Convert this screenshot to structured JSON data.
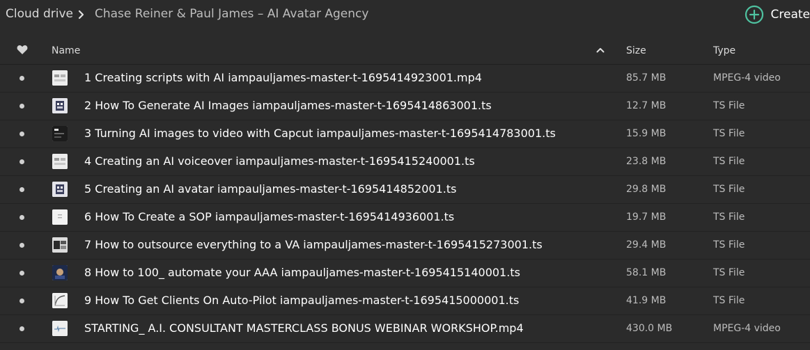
{
  "breadcrumb": {
    "root": "Cloud drive",
    "current": "Chase Reiner & Paul James – AI Avatar Agency"
  },
  "toolbar": {
    "create_label": "Create",
    "create_icon": "plus-circle-icon",
    "accent": "#4fc3a1"
  },
  "columns": {
    "favourite_icon": "heart-icon",
    "name": "Name",
    "size": "Size",
    "type": "Type",
    "sort_icon": "chevron-up-icon"
  },
  "files": [
    {
      "name": "1 Creating scripts with AI iampauljames-master-t-1695414923001.mp4",
      "size": "85.7 MB",
      "type": "MPEG-4 video",
      "thumb": "light"
    },
    {
      "name": "2 How To Generate AI Images iampauljames-master-t-1695414863001.ts",
      "size": "12.7 MB",
      "type": "TS File",
      "thumb": "grid"
    },
    {
      "name": "3 Turning AI images to video with Capcut iampauljames-master-t-1695414783001.ts",
      "size": "15.9 MB",
      "type": "TS File",
      "thumb": "dark"
    },
    {
      "name": "4 Creating an AI voiceover iampauljames-master-t-1695415240001.ts",
      "size": "23.8 MB",
      "type": "TS File",
      "thumb": "light"
    },
    {
      "name": "5 Creating an AI avatar iampauljames-master-t-1695414852001.ts",
      "size": "29.8 MB",
      "type": "TS File",
      "thumb": "grid"
    },
    {
      "name": "6 How To Create a SOP iampauljames-master-t-1695414936001.ts",
      "size": "19.7 MB",
      "type": "TS File",
      "thumb": "doc"
    },
    {
      "name": "7 How to outsource everything to a VA iampauljames-master-t-1695415273001.ts",
      "size": "29.4 MB",
      "type": "TS File",
      "thumb": "split"
    },
    {
      "name": "8 How to 100_ automate your AAA iampauljames-master-t-1695415140001.ts",
      "size": "58.1 MB",
      "type": "TS File",
      "thumb": "photo"
    },
    {
      "name": "9 How To Get Clients On Auto-Pilot iampauljames-master-t-1695415000001.ts",
      "size": "41.9 MB",
      "type": "TS File",
      "thumb": "curve"
    },
    {
      "name": "STARTING_ A.I. CONSULTANT MASTERCLASS BONUS WEBINAR WORKSHOP.mp4",
      "size": "430.0 MB",
      "type": "MPEG-4 video",
      "thumb": "wave"
    }
  ]
}
